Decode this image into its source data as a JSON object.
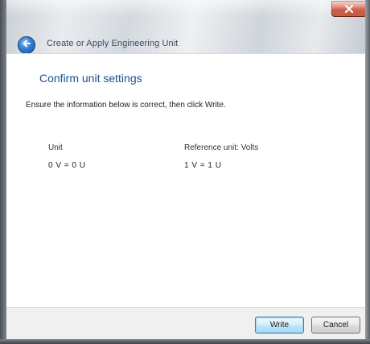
{
  "window": {
    "title": "Create or Apply Engineering Unit",
    "close_icon": "close-icon",
    "back_icon": "back-arrow-icon"
  },
  "page": {
    "heading": "Confirm unit settings",
    "instruction": "Ensure the information below is correct, then click Write."
  },
  "settings": {
    "unit_label": "Unit",
    "unit_value": "0 V = 0 U",
    "reference_label": "Reference unit: Volts",
    "reference_value": "1 V = 1 U"
  },
  "footer": {
    "write_label": "Write",
    "cancel_label": "Cancel"
  },
  "colors": {
    "heading": "#1e4e92",
    "close_button": "#d2462f",
    "back_button": "#2f7fd6"
  }
}
